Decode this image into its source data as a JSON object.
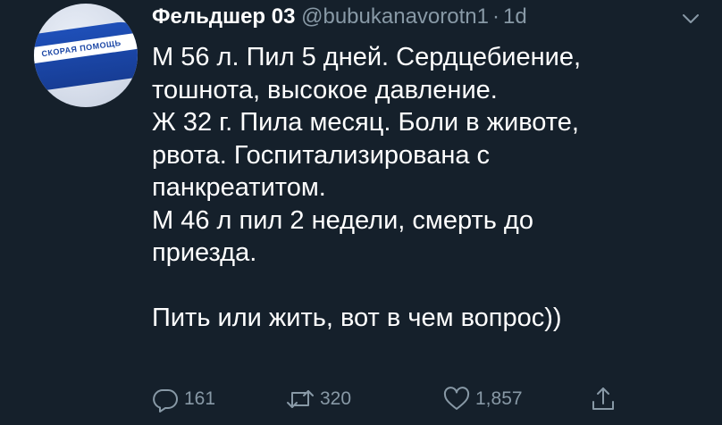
{
  "author": {
    "name": "Фельдшер 03",
    "handle": "@bubukanavorotn1",
    "separator": "·",
    "time": "1d",
    "avatar_patch_text": "СКОРАЯ ПОМОЩЬ"
  },
  "tweet": {
    "lines": [
      "М 56 л. Пил 5 дней. Сердцебиение,",
      "тошнота, высокое давление.",
      "Ж 32 г. Пила месяц. Боли в животе,",
      "рвота. Госпитализирована с",
      "панкреатитом.",
      "М 46 л пил 2 недели, смерть до",
      "приезда.",
      "Пить или жить, вот в чем вопрос))"
    ]
  },
  "actions": {
    "replies": "161",
    "retweets": "320",
    "likes": "1,857"
  },
  "icons": {
    "reply": "reply-icon",
    "retweet": "retweet-icon",
    "like": "heart-icon",
    "share": "share-icon",
    "menu": "chevron-down-icon"
  },
  "colors": {
    "background": "#15202b",
    "text": "#ffffff",
    "secondary": "#8899a6"
  }
}
